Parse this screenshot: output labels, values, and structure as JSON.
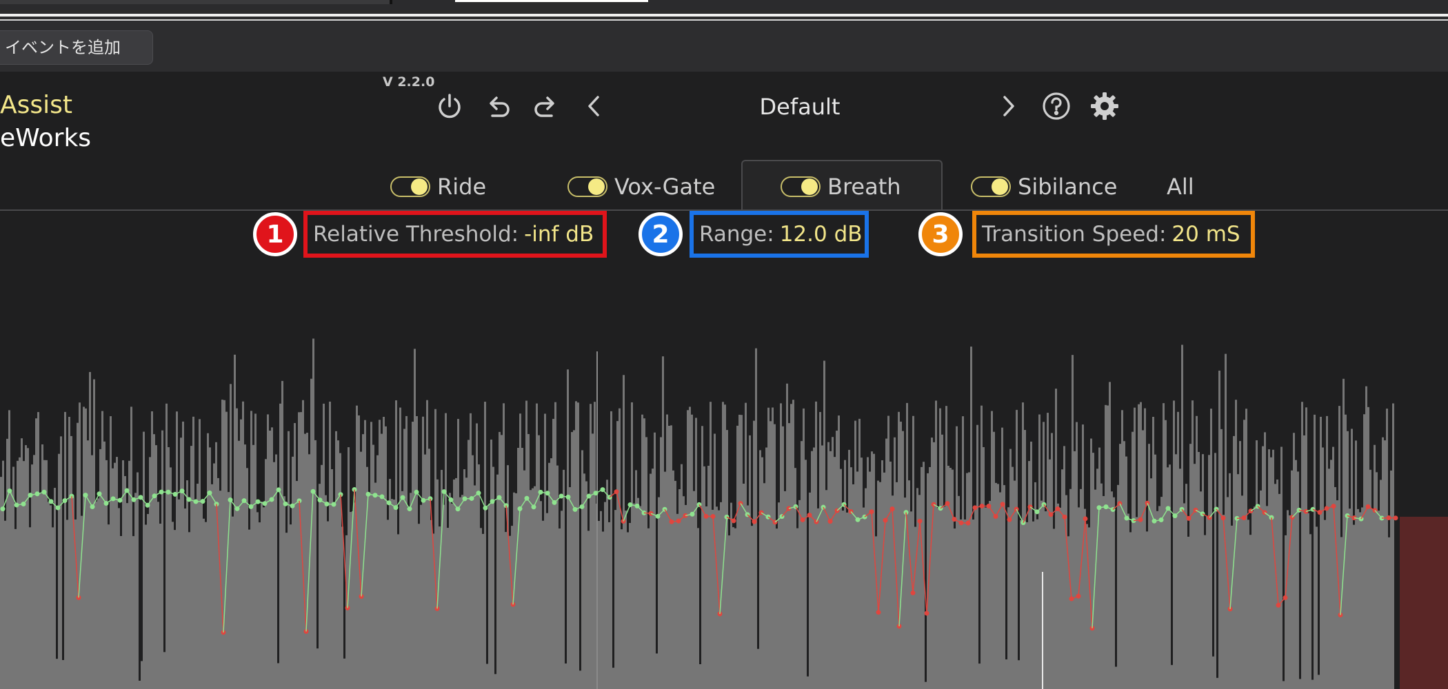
{
  "host": {
    "add_event_label": "イベントを追加"
  },
  "plugin": {
    "brand_accent": "Assist",
    "brand_name": "eWorks",
    "version": "V 2.2.0",
    "preset": "Default",
    "toolbar_icons": [
      "power-icon",
      "undo-icon",
      "redo-icon",
      "prev-preset-icon",
      "next-preset-icon",
      "help-icon",
      "settings-icon"
    ]
  },
  "tabs": [
    {
      "label": "Ride",
      "toggle_on": true,
      "active": false
    },
    {
      "label": "Vox-Gate",
      "toggle_on": true,
      "active": false
    },
    {
      "label": "Breath",
      "toggle_on": true,
      "active": true
    },
    {
      "label": "Sibilance",
      "toggle_on": true,
      "active": false
    },
    {
      "label": "All",
      "toggle_on": null,
      "active": false
    }
  ],
  "params": [
    {
      "badge": "1",
      "label": "Relative Threshold:",
      "value": "-inf dB",
      "color": "#e0141b"
    },
    {
      "badge": "2",
      "label": "Range:",
      "value": "12.0 dB",
      "color": "#1a73e8"
    },
    {
      "badge": "3",
      "label": "Transition Speed:",
      "value": "20 mS",
      "color": "#f0860a"
    }
  ],
  "colors": {
    "accent_yellow": "#f3e68a",
    "waveform_gray": "#767676",
    "gain_green": "#8fe38f",
    "gain_red": "#e0463f"
  }
}
